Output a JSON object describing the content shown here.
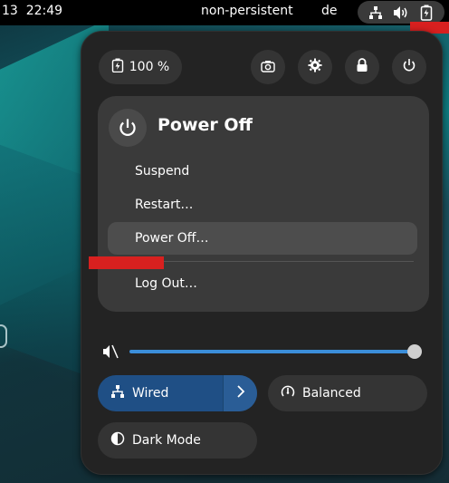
{
  "topbar": {
    "clock": "13  22:49",
    "session_name": "non-persistent",
    "keyboard_layout": "de",
    "status_icons": [
      "network-wired-icon",
      "volume-icon",
      "battery-icon"
    ]
  },
  "quick_settings": {
    "battery_label": "100 %",
    "buttons": [
      "screenshot-icon",
      "settings-icon",
      "lock-icon",
      "power-icon"
    ],
    "power_menu": {
      "title": "Power Off",
      "items": {
        "suspend": "Suspend",
        "restart": "Restart…",
        "power_off": "Power Off…",
        "log_out": "Log Out…"
      }
    },
    "volume": {
      "icon": "speaker-muted-icon",
      "level_percent": 100
    },
    "toggles": {
      "wired": "Wired",
      "power_mode": "Balanced",
      "dark_mode": "Dark Mode"
    }
  },
  "colors": {
    "accent": "#3b8eda",
    "active_toggle": "#1f4f85",
    "menu_background": "#232323",
    "annotation_mark": "#d8201f"
  }
}
